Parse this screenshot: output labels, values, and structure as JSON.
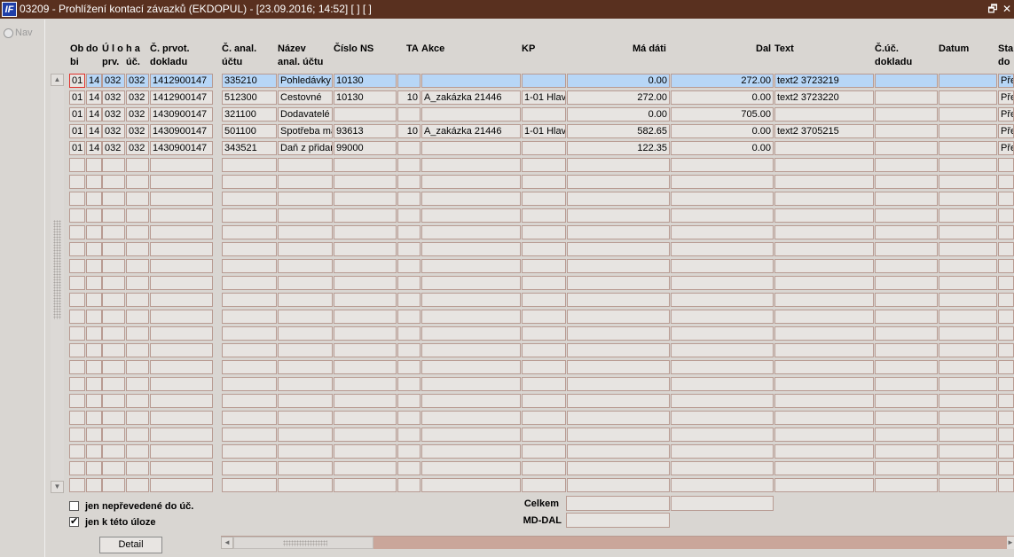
{
  "window": {
    "title": "03209 - Prohlížení kontací závazků (EKDOPUL) - [23.09.2016; 14:52] [ ] [ ]",
    "icon_text": "IF",
    "restore_glyph": "🗗",
    "close_glyph": "✕"
  },
  "nav": {
    "label": "Nav"
  },
  "columns": [
    {
      "key": "ob",
      "label": "Ob\nbi"
    },
    {
      "key": "do",
      "label": "do"
    },
    {
      "key": "ulo",
      "label": "Ú l o\nprv."
    },
    {
      "key": "ha",
      "label": "h a\núč."
    },
    {
      "key": "cprvot",
      "label": "Č. prvot.\ndokladu"
    },
    {
      "key": "canal",
      "label": "Č. anal.\núčtu"
    },
    {
      "key": "nazev",
      "label": "Název\nanal. účtu"
    },
    {
      "key": "ns",
      "label": "Číslo NS"
    },
    {
      "key": "ta",
      "label": "TA"
    },
    {
      "key": "akce",
      "label": "Akce"
    },
    {
      "key": "kp",
      "label": "KP"
    },
    {
      "key": "madati",
      "label": "Má dáti"
    },
    {
      "key": "dal",
      "label": "Dal"
    },
    {
      "key": "text",
      "label": "Text"
    },
    {
      "key": "cuc",
      "label": "Č.úč.\ndokladu"
    },
    {
      "key": "datum",
      "label": "Datum"
    },
    {
      "key": "stav",
      "label": "Sta\ndo"
    }
  ],
  "rows": [
    [
      "01",
      "14",
      "032",
      "032",
      "1412900147",
      "335210",
      "Pohledávky",
      "10130",
      "",
      "",
      "",
      "0.00",
      "272.00",
      "text2 3723219",
      "",
      "",
      "Přev"
    ],
    [
      "01",
      "14",
      "032",
      "032",
      "1412900147",
      "512300",
      "Cestovné",
      "10130",
      "10",
      "A_zakázka 21446",
      "1-01 Hlav",
      "272.00",
      "0.00",
      "text2 3723220",
      "",
      "",
      "Přev"
    ],
    [
      "01",
      "14",
      "032",
      "032",
      "1430900147",
      "321100",
      "Dodavatelé",
      "",
      "",
      "",
      "",
      "0.00",
      "705.00",
      "",
      "",
      "",
      "Přev"
    ],
    [
      "01",
      "14",
      "032",
      "032",
      "1430900147",
      "501100",
      "Spotřeba ma",
      "93613",
      "10",
      "A_zakázka 21446",
      "1-01 Hlav",
      "582.65",
      "0.00",
      "text2 3705215",
      "",
      "",
      "Přev"
    ],
    [
      "01",
      "14",
      "032",
      "032",
      "1430900147",
      "343521",
      "Daň z přidan",
      "99000",
      "",
      "",
      "",
      "122.35",
      "0.00",
      "",
      "",
      "",
      "Přev"
    ]
  ],
  "empty_row_count": 20,
  "filters": {
    "not_transferred": {
      "label": "jen nepřevedené do úč.",
      "checked": false
    },
    "this_task": {
      "label": "jen k této úloze",
      "checked": true,
      "mark": "✔"
    }
  },
  "summary": {
    "total_label": "Celkem",
    "md_dal_label": "MD-DAL"
  },
  "buttons": {
    "detail": "Detail"
  },
  "scroll_glyphs": {
    "up": "▲",
    "down": "▼",
    "left": "◄",
    "right": "►"
  }
}
